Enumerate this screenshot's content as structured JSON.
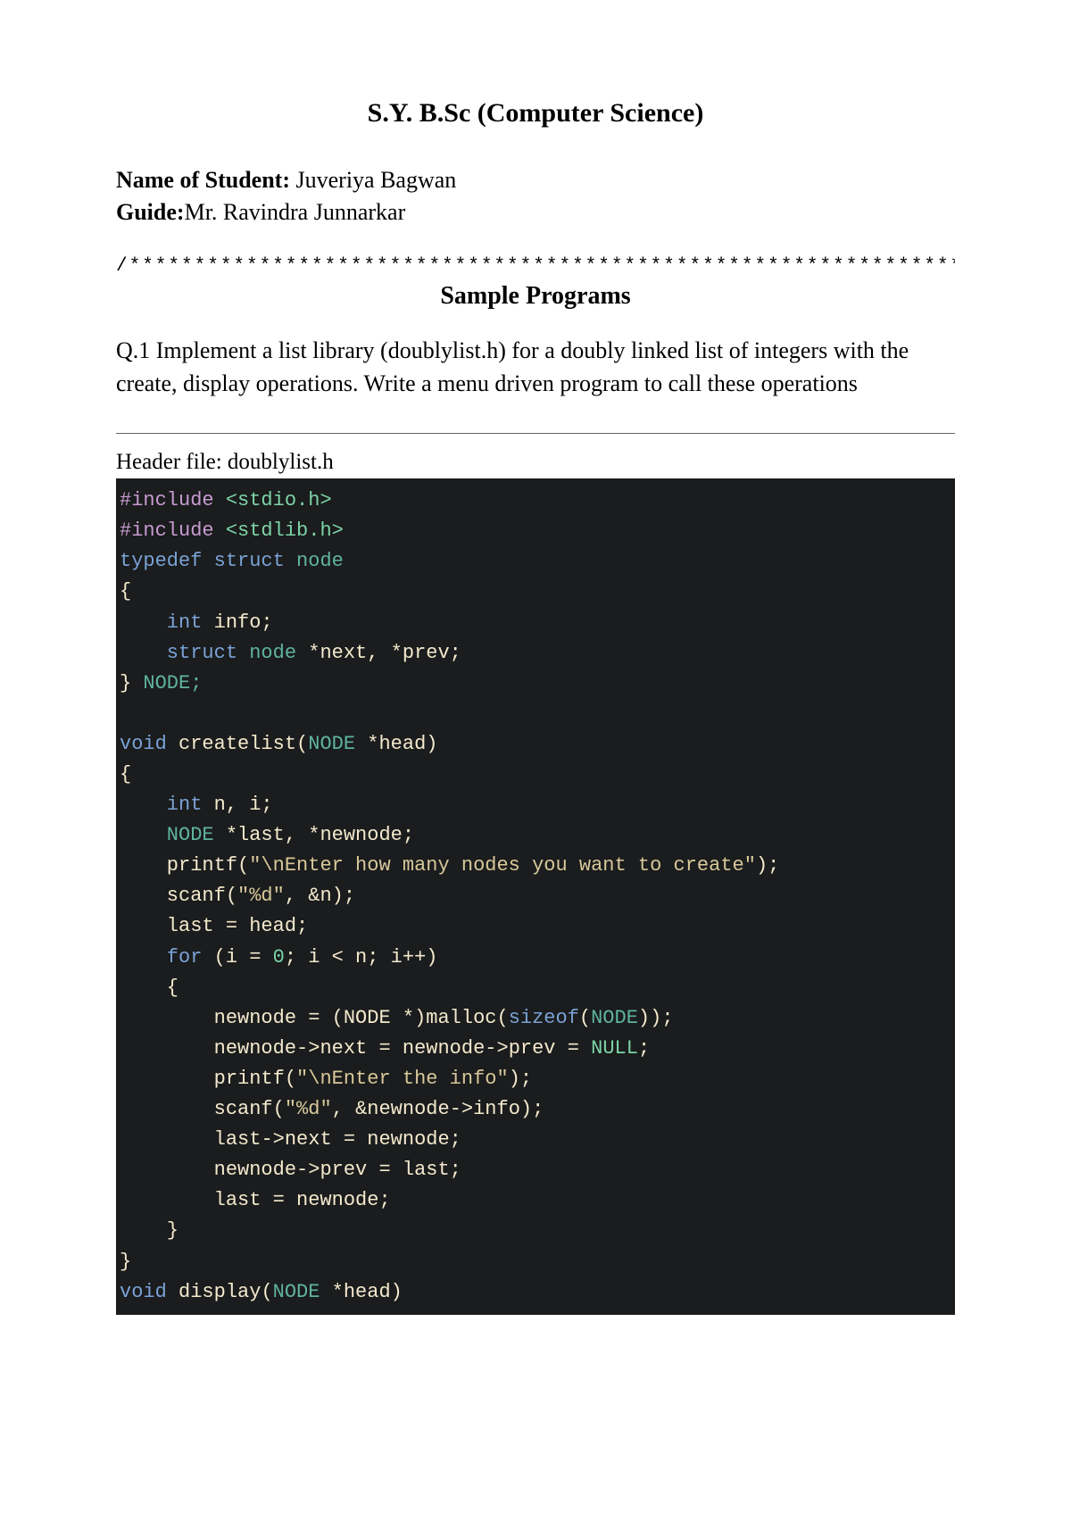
{
  "title": "S.Y. B.Sc (Computer Science)",
  "student_label": "Name of Student: ",
  "student_name": "Juveriya Bagwan",
  "guide_label": "Guide:",
  "guide_name": "Mr. Ravindra Junnarkar",
  "separator": "/****************************************************************/",
  "section_heading": "Sample Programs",
  "question": "Q.1 Implement a list library (doublylist.h) for a doubly linked list of integers with the create, display operations. Write a menu driven program to call these operations",
  "header_file_label": "Header file: doublylist.h",
  "code": {
    "l1a": "#include",
    "l1b": " <stdio.h>",
    "l2a": "#include",
    "l2b": " <stdlib.h>",
    "l3a": "typedef",
    "l3b": " struct",
    "l3c": " node",
    "l4": "{",
    "l5a": "    int",
    "l5b": " info;",
    "l6a": "    struct",
    "l6b": " node ",
    "l6c": "*",
    "l6d": "next, ",
    "l6e": "*",
    "l6f": "prev;",
    "l7a": "}",
    "l7b": " NODE;",
    "l8": "",
    "l9a": "void",
    "l9b": " createlist",
    "l9c": "(",
    "l9d": "NODE ",
    "l9e": "*",
    "l9f": "head",
    "l9g": ")",
    "l10": "{",
    "l11a": "    int",
    "l11b": " n, i;",
    "l12a": "    NODE ",
    "l12b": "*",
    "l12c": "last, ",
    "l12d": "*",
    "l12e": "newnode;",
    "l13a": "    printf",
    "l13b": "(",
    "l13c": "\"\\nEnter how many nodes you want to create\"",
    "l13d": ");",
    "l14a": "    scanf",
    "l14b": "(",
    "l14c": "\"%d\"",
    "l14d": ", ",
    "l14e": "&",
    "l14f": "n);",
    "l15": "    last = head;",
    "l16a": "    for",
    "l16b": " (i = ",
    "l16c": "0",
    "l16d": "; i < n; i",
    "l16e": "++",
    "l16f": ")",
    "l17": "    {",
    "l18a": "        newnode = (NODE ",
    "l18b": "*",
    "l18c": ")",
    "l18d": "malloc",
    "l18e": "(",
    "l18f": "sizeof",
    "l18g": "(",
    "l18h": "NODE",
    "l18i": "));",
    "l19a": "        newnode",
    "l19b": "->",
    "l19c": "next = newnode",
    "l19d": "->",
    "l19e": "prev = ",
    "l19f": "NULL",
    "l19g": ";",
    "l20a": "        printf",
    "l20b": "(",
    "l20c": "\"\\nEnter the info\"",
    "l20d": ");",
    "l21a": "        scanf",
    "l21b": "(",
    "l21c": "\"%d\"",
    "l21d": ", ",
    "l21e": "&",
    "l21f": "newnode",
    "l21g": "->",
    "l21h": "info);",
    "l22a": "        last",
    "l22b": "->",
    "l22c": "next = newnode;",
    "l23a": "        newnode",
    "l23b": "->",
    "l23c": "prev = last;",
    "l24": "        last = newnode;",
    "l25": "    }",
    "l26": "}",
    "l27a": "void",
    "l27b": " display",
    "l27c": "(",
    "l27d": "NODE ",
    "l27e": "*",
    "l27f": "head",
    "l27g": ")"
  }
}
